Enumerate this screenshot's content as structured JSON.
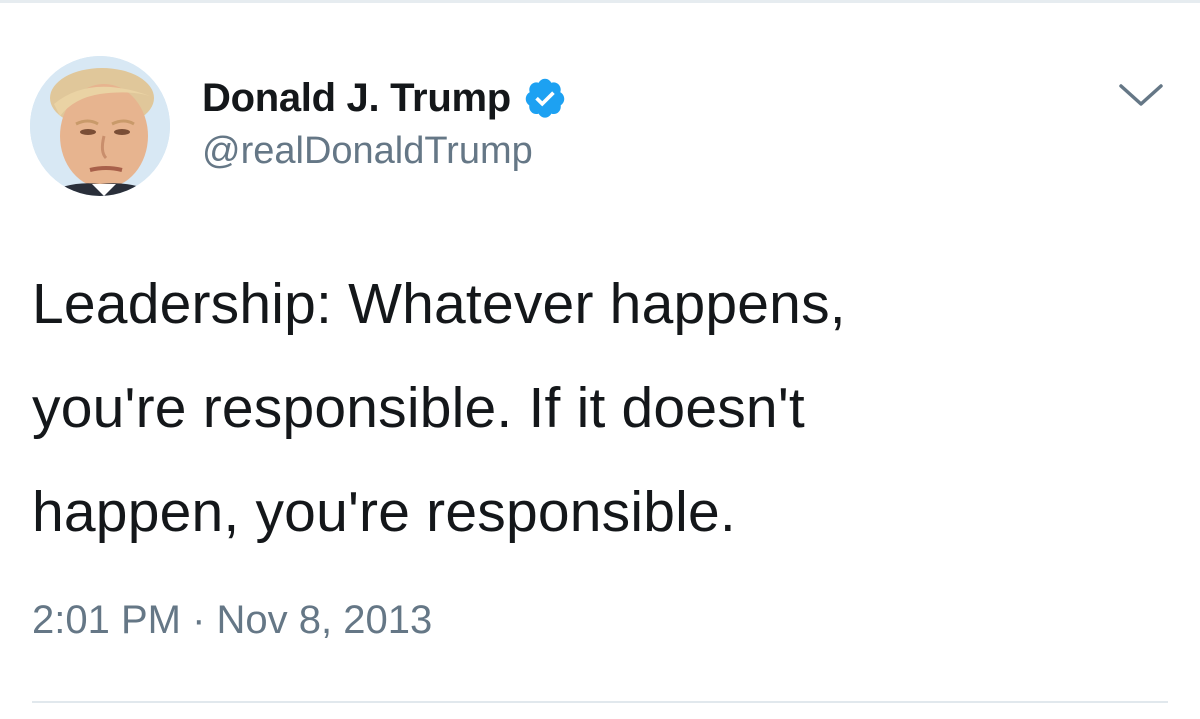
{
  "tweet": {
    "author": {
      "display_name": "Donald J. Trump",
      "handle": "@realDonaldTrump",
      "verified": true,
      "avatar_icon": "profile-photo"
    },
    "text_lines": [
      "Leadership: Whatever happens,",
      "you're responsible. If it doesn't",
      "happen, you're responsible."
    ],
    "timestamp": "2:01 PM · Nov 8, 2013",
    "menu_icon": "chevron-down-icon"
  },
  "colors": {
    "text_primary": "#14171a",
    "text_secondary": "#657786",
    "verified_blue": "#1da1f2",
    "divider": "#e1e8ed"
  }
}
